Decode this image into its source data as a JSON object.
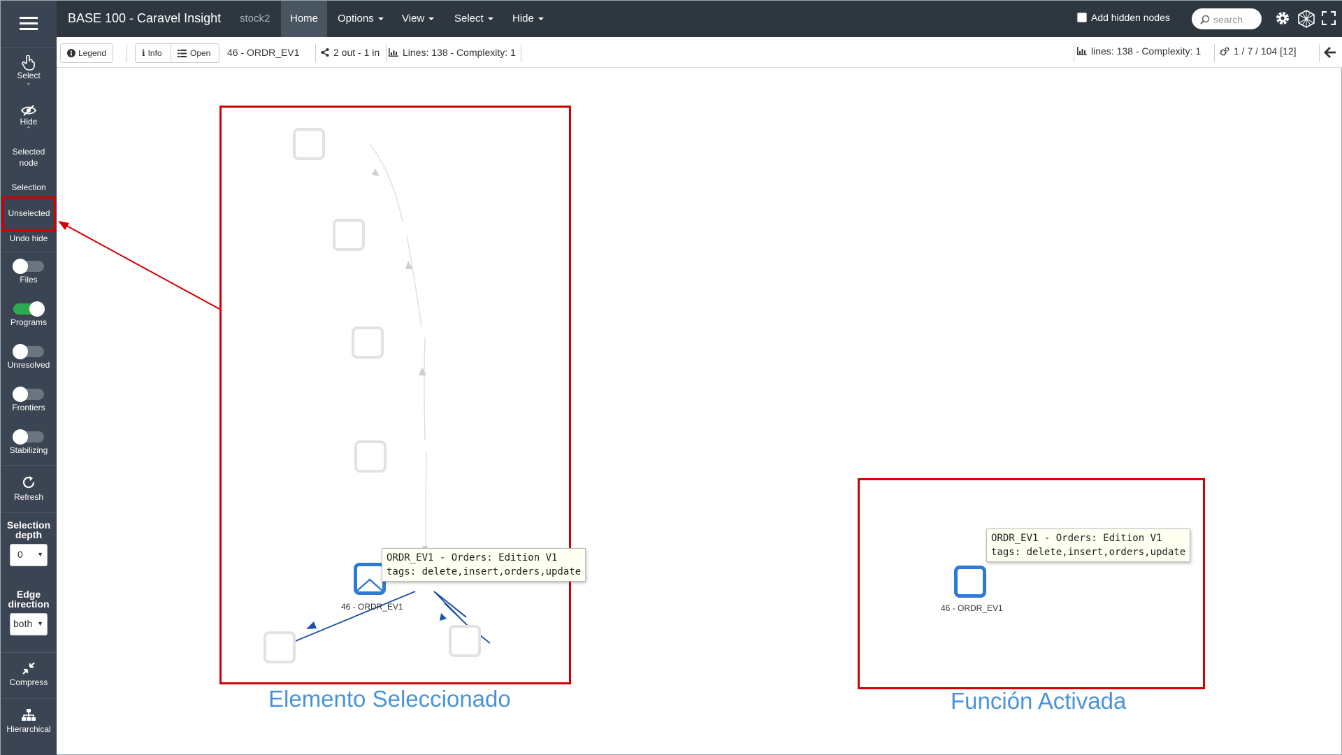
{
  "sidebar": {
    "select_label": "Select",
    "hide_label": "Hide",
    "selected_node_label": "Selected node",
    "selection_label": "Selection",
    "unselected_label": "Unselected",
    "undo_hide_label": "Undo hide",
    "toggles": {
      "files": {
        "label": "Files",
        "on": false
      },
      "programs": {
        "label": "Programs",
        "on": true
      },
      "unresolved": {
        "label": "Unresolved",
        "on": false
      },
      "frontiers": {
        "label": "Frontiers",
        "on": false
      },
      "stabilizing": {
        "label": "Stabilizing",
        "on": false
      }
    },
    "refresh_label": "Refresh",
    "selection_depth_label": "Selection depth",
    "selection_depth_value": "0",
    "edge_direction_label": "Edge direction",
    "edge_direction_value": "both",
    "compress_label": "Compress",
    "hierarchical_label": "Hierarchical"
  },
  "navbar": {
    "title": "BASE 100 - Caravel Insight",
    "db": "stock2",
    "home": "Home",
    "options": "Options",
    "view": "View",
    "select": "Select",
    "hide": "Hide",
    "add_hidden_nodes": "Add hidden nodes",
    "search_placeholder": "search"
  },
  "toolbar": {
    "legend": "Legend",
    "info": "Info",
    "open": "Open",
    "node_name": "46 - ORDR_EV1",
    "edges": "2 out - 1 in",
    "lines": "Lines: 138 - Complexity: 1",
    "right_lines": "lines: 138 - Complexity: 1",
    "right_counts": "1 / 7 / 104 [12]"
  },
  "graph": {
    "selected_label": "46 - ORDR_EV1",
    "tooltip_line1": "ORDR_EV1 - Orders: Edition V1",
    "tooltip_line2": "tags: delete,insert,orders,update",
    "activated_label": "46 - ORDR_EV1",
    "activated_tooltip_line1": "ORDR_EV1 - Orders: Edition V1",
    "activated_tooltip_line2": "tags: delete,insert,orders,update"
  },
  "captions": {
    "left": "Elemento Seleccionado",
    "right": "Función Activada"
  },
  "colors": {
    "highlight_red": "#d40000",
    "selected_blue": "#2f7ad6",
    "edge_blue": "#1f4fa8",
    "caption_blue": "#4a93d9",
    "toggle_green": "#2fa84f"
  }
}
